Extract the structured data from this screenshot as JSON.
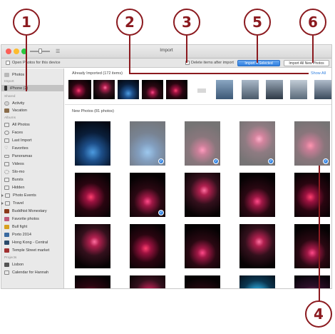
{
  "callouts": [
    "1",
    "2",
    "3",
    "5",
    "6",
    "4"
  ],
  "window": {
    "title": "Import",
    "option_label": "Open Photos for this device",
    "delete_label": "Delete items after import",
    "import_selected_label": "Import 4 Selected",
    "import_all_label": "Import All New Photos"
  },
  "sidebar": {
    "photos": "Photos",
    "import_header": "Import",
    "iphone": "iPhone (2)",
    "shared_header": "Shared",
    "activity": "Activity",
    "vacation": "Vacation",
    "albums_header": "Albums",
    "albums": [
      "All Photos",
      "Faces",
      "Last Import",
      "Favorites",
      "Panoramas",
      "Videos",
      "Slo-mo",
      "Bursts",
      "Hidden",
      "Photo Events",
      "Travel",
      "Buddhist Monestary",
      "Favorite photos",
      "Bull fight",
      "Porto 2014",
      "Hong Kong - Central",
      "Temple Street market"
    ],
    "projects_header": "Projects",
    "projects": [
      "Lisbon",
      "Calendar for Hannah"
    ]
  },
  "main": {
    "already_imported": "Already Imported (172 items)",
    "show_all": "Show All",
    "new_photos": "New Photos (81 photos)"
  },
  "colors": {
    "callout": "#8b1a1f",
    "accent_blue": "#2f7fe0"
  }
}
